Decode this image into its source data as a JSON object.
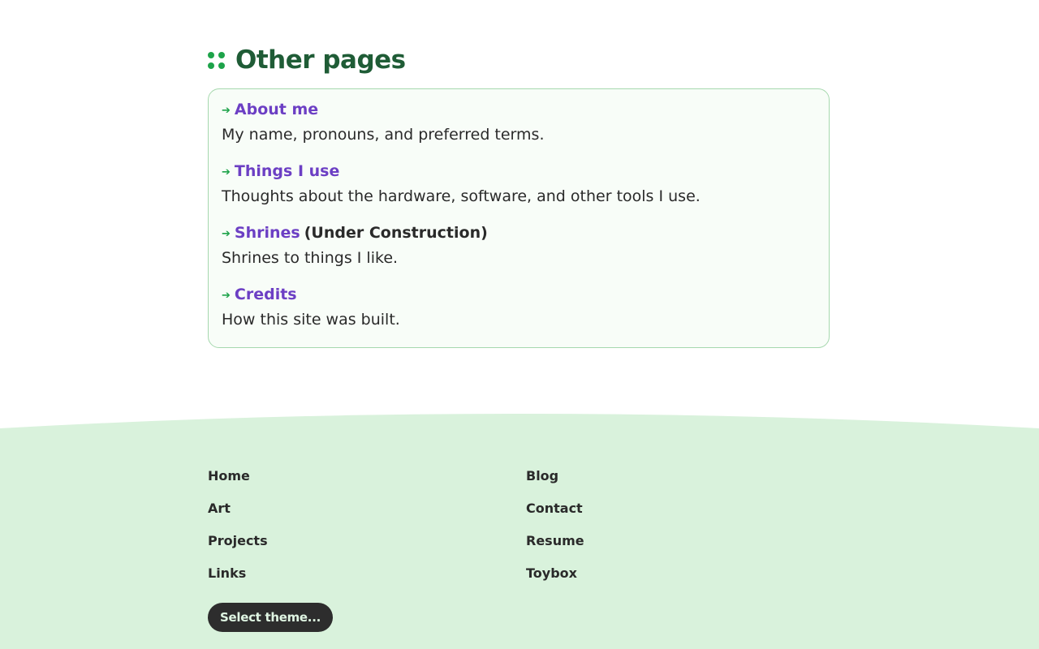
{
  "section": {
    "title": "Other pages"
  },
  "pages": [
    {
      "link": "About me",
      "note": "",
      "description": "My name, pronouns, and preferred terms."
    },
    {
      "link": "Things I use",
      "note": "",
      "description": "Thoughts about the hardware, software, and other tools I use."
    },
    {
      "link": "Shrines",
      "note": "(Under Construction)",
      "description": "Shrines to things I like."
    },
    {
      "link": "Credits",
      "note": "",
      "description": "How this site was built."
    }
  ],
  "footer": {
    "left_links": [
      "Home",
      "Art",
      "Projects",
      "Links"
    ],
    "right_links": [
      "Blog",
      "Contact",
      "Resume",
      "Toybox"
    ],
    "theme_button": "Select theme..."
  },
  "colors": {
    "accent_green": "#1ea34a",
    "title_green": "#1f5c36",
    "link_purple": "#6c3fc4",
    "footer_bg": "#d9f2dc"
  }
}
